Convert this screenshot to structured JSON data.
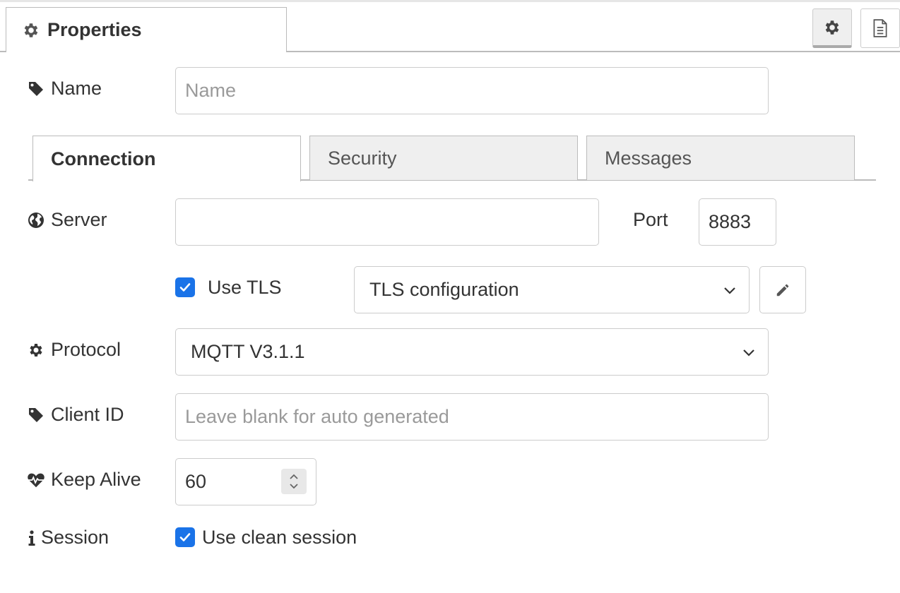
{
  "header": {
    "tab_title": "Properties",
    "settings_icon": "gear-icon",
    "info_icon": "document-icon"
  },
  "name_row": {
    "label": "Name",
    "placeholder": "Name",
    "value": ""
  },
  "tabs": [
    {
      "label": "Connection",
      "active": true
    },
    {
      "label": "Security",
      "active": false
    },
    {
      "label": "Messages",
      "active": false
    }
  ],
  "server_row": {
    "label": "Server",
    "value": "",
    "port_label": "Port",
    "port_value": "8883"
  },
  "tls": {
    "checked": true,
    "label": "Use TLS",
    "config_value": "TLS configuration",
    "edit_icon": "pencil-icon"
  },
  "protocol_row": {
    "label": "Protocol",
    "value": "MQTT V3.1.1"
  },
  "client_id_row": {
    "label": "Client ID",
    "placeholder": "Leave blank for auto generated",
    "value": ""
  },
  "keep_alive_row": {
    "label": "Keep Alive",
    "value": "60"
  },
  "session_row": {
    "label": "Session",
    "checked": true,
    "option_label": "Use clean session"
  },
  "colors": {
    "accent": "#1a73e8",
    "border": "#cccccc",
    "inactive_tab": "#efefef"
  }
}
